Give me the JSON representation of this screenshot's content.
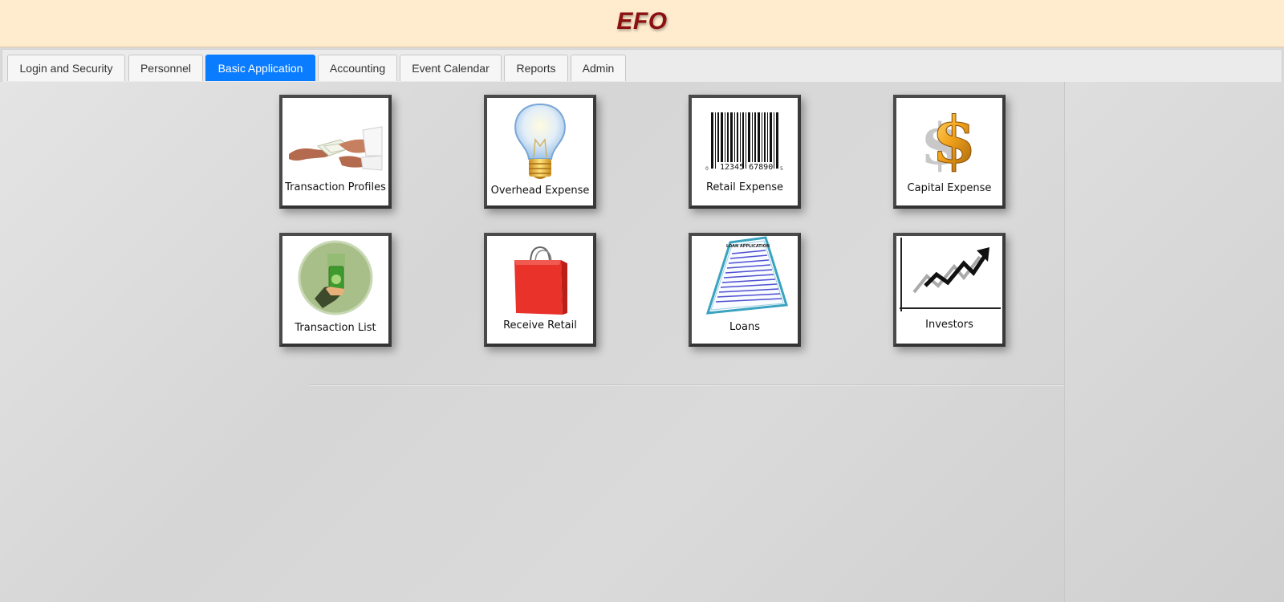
{
  "header": {
    "brand": "EFO"
  },
  "tabs": [
    {
      "label": "Login and Security"
    },
    {
      "label": "Personnel"
    },
    {
      "label": "Basic Application",
      "active": true
    },
    {
      "label": "Accounting"
    },
    {
      "label": "Event Calendar"
    },
    {
      "label": "Reports"
    },
    {
      "label": "Admin"
    }
  ],
  "tiles": [
    {
      "label": "Transaction Profiles",
      "icon": "handing-money-icon"
    },
    {
      "label": "Overhead Expense",
      "icon": "light-bulb-icon"
    },
    {
      "label": "Retail Expense",
      "icon": "barcode-icon",
      "barcode_text": "12345 67890",
      "barcode_left": "0",
      "barcode_right": "5"
    },
    {
      "label": "Capital Expense",
      "icon": "dollar-sign-icon"
    },
    {
      "label": "Transaction List",
      "icon": "hand-with-cash-icon"
    },
    {
      "label": "Receive Retail",
      "icon": "shopping-bag-icon"
    },
    {
      "label": "Loans",
      "icon": "loan-application-icon",
      "document_title": "LOAN APPLICATION"
    },
    {
      "label": "Investors",
      "icon": "growth-chart-icon"
    }
  ],
  "colors": {
    "header_bg": "#ffeccf",
    "brand": "#8b1010",
    "active_tab": "#0a7cff"
  }
}
